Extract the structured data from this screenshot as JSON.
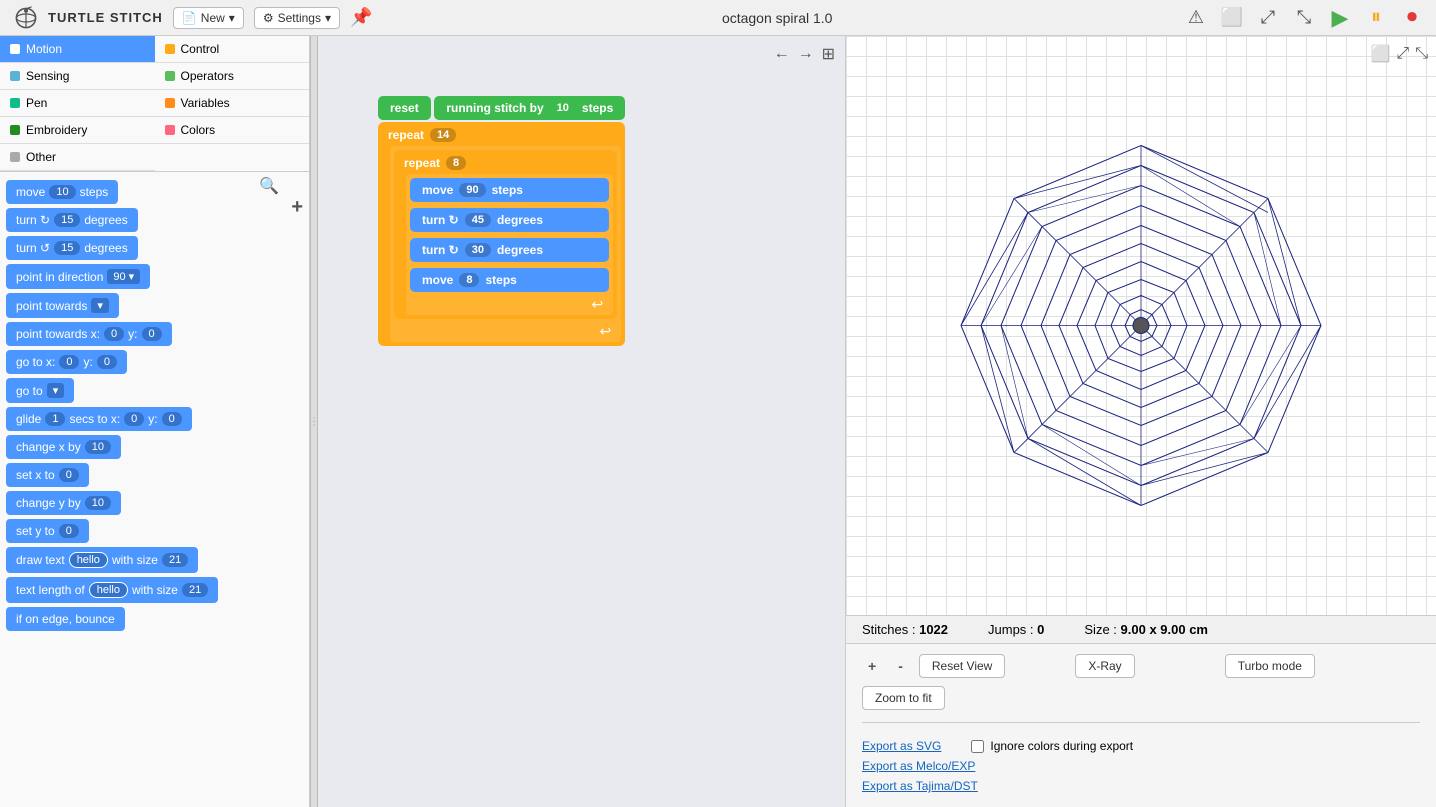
{
  "topbar": {
    "logo_text": "TURTLE STITCH",
    "new_btn": "New",
    "settings_btn": "Settings",
    "project_title": "octagon spiral 1.0",
    "warning_icon": "⚠",
    "fullscreen_icon": "⛶",
    "expand_icon": "⤢",
    "fit_icon": "⤡"
  },
  "categories": [
    {
      "id": "motion",
      "label": "Motion",
      "color": "#4c97ff",
      "active": true
    },
    {
      "id": "control",
      "label": "Control",
      "color": "#ffab19"
    },
    {
      "id": "sensing",
      "label": "Sensing",
      "color": "#5cb1d6"
    },
    {
      "id": "operators",
      "label": "Operators",
      "color": "#59c059"
    },
    {
      "id": "pen",
      "label": "Pen",
      "color": "#0fbd8c"
    },
    {
      "id": "variables",
      "label": "Variables",
      "color": "#ff8c1a"
    },
    {
      "id": "embroidery",
      "label": "Embroidery",
      "color": "#228b22"
    },
    {
      "id": "colors",
      "label": "Colors",
      "color": "#ff6680"
    },
    {
      "id": "other",
      "label": "Other",
      "color": "#aaa"
    }
  ],
  "blocks": [
    {
      "id": "move",
      "text": "move",
      "val": "10",
      "suffix": "steps"
    },
    {
      "id": "turn_cw",
      "text": "turn ↻",
      "val": "15",
      "suffix": "degrees"
    },
    {
      "id": "turn_ccw",
      "text": "turn ↺",
      "val": "15",
      "suffix": "degrees"
    },
    {
      "id": "point_dir",
      "text": "point in direction",
      "val": "90",
      "dropdown": true
    },
    {
      "id": "point_towards",
      "text": "point towards",
      "dropdown": true
    },
    {
      "id": "point_towards_xy",
      "text": "point towards x:",
      "val1": "0",
      "val2": "0"
    },
    {
      "id": "go_to_xy",
      "text": "go to x:",
      "val1": "0",
      "val2": "0"
    },
    {
      "id": "go_to",
      "text": "go to",
      "dropdown": true
    },
    {
      "id": "glide",
      "text": "glide",
      "val1": "1",
      "suffix1": "secs to x:",
      "val2": "0",
      "suffix2": "y:",
      "val3": "0"
    },
    {
      "id": "change_x",
      "text": "change x by",
      "val": "10"
    },
    {
      "id": "set_x",
      "text": "set x to",
      "val": "0"
    },
    {
      "id": "change_y",
      "text": "change y by",
      "val": "10"
    },
    {
      "id": "set_y",
      "text": "set y to",
      "val": "0"
    },
    {
      "id": "draw_text",
      "text": "draw text",
      "val1": "hello",
      "suffix": "with size",
      "val2": "21"
    },
    {
      "id": "text_length",
      "text": "text length of",
      "val1": "hello",
      "suffix": "with size",
      "val2": "21"
    },
    {
      "id": "if_on_edge",
      "text": "if on edge, bounce"
    }
  ],
  "script": {
    "blocks": [
      {
        "type": "green",
        "text": "reset"
      },
      {
        "type": "green",
        "text": "running stitch by",
        "val": "10",
        "suffix": "steps"
      },
      {
        "type": "repeat_outer",
        "val": "14",
        "children": [
          {
            "type": "repeat_inner",
            "val": "8",
            "children": [
              {
                "type": "blue2",
                "text": "move",
                "val": "90",
                "suffix": "steps"
              },
              {
                "type": "blue2",
                "text": "turn",
                "val": "45",
                "suffix": "degrees",
                "icon": "↻"
              },
              {
                "type": "blue2",
                "text": "turn",
                "val": "30",
                "suffix": "degrees",
                "icon": "↻"
              },
              {
                "type": "blue2",
                "text": "move",
                "val": "8",
                "suffix": "steps"
              }
            ]
          }
        ]
      }
    ]
  },
  "stats": {
    "stitches_label": "Stitches :",
    "stitches_value": "1022",
    "jumps_label": "Jumps :",
    "jumps_value": "0",
    "size_label": "Size :",
    "size_value": "9.00 x 9.00 cm"
  },
  "controls": {
    "plus": "+",
    "minus": "-",
    "reset_view": "Reset View",
    "x_ray": "X-Ray",
    "turbo_mode": "Turbo mode",
    "zoom_to_fit": "Zoom to fit",
    "ignore_colors": "Ignore colors during export",
    "export_svg": "Export as SVG",
    "export_melco": "Export as Melco/EXP",
    "export_tajima": "Export as Tajima/DST"
  }
}
